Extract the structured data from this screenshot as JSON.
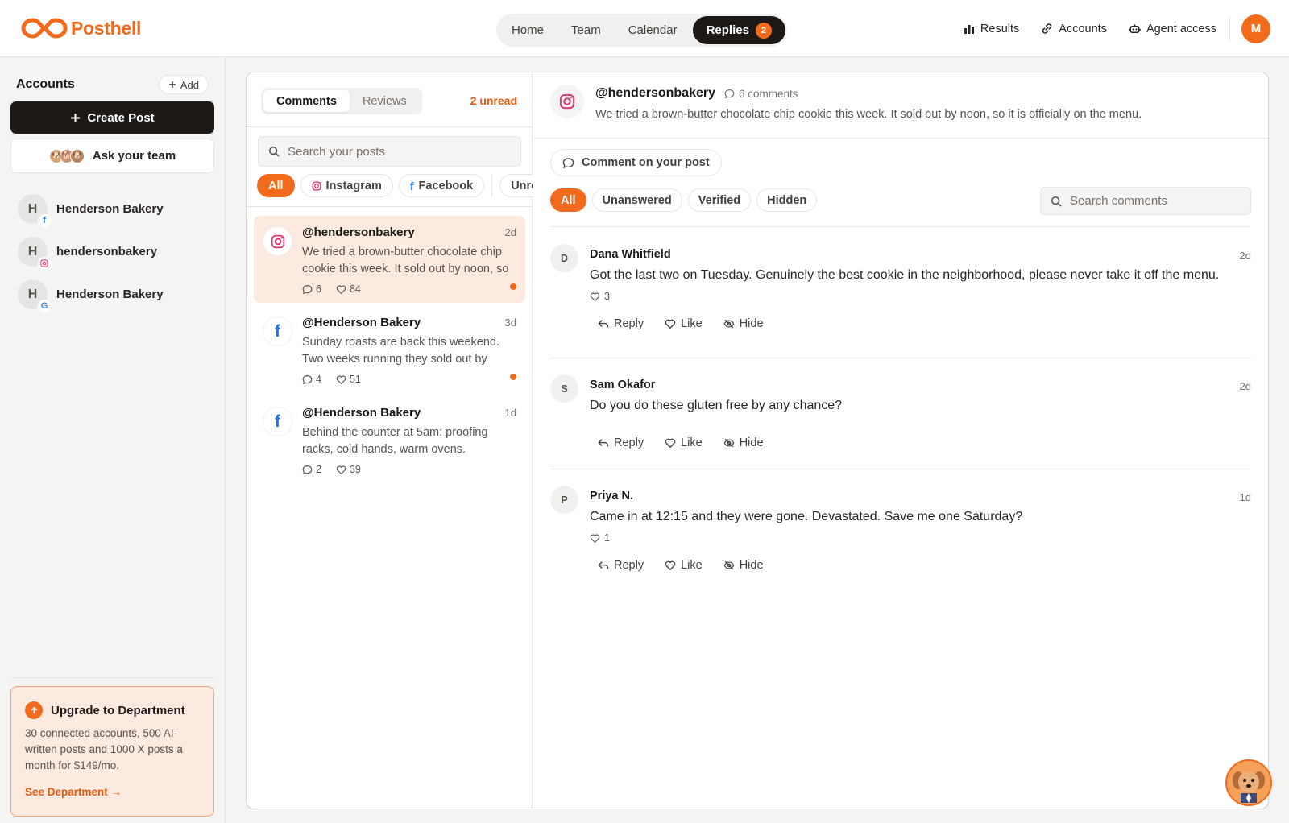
{
  "app": {
    "brand": "Posthell"
  },
  "nav": {
    "items": [
      {
        "label": "Home",
        "active": false
      },
      {
        "label": "Team",
        "active": false
      },
      {
        "label": "Calendar",
        "active": false
      }
    ],
    "replies": {
      "label": "Replies",
      "badge": "2"
    }
  },
  "top_right": {
    "results": "Results",
    "accounts": "Accounts",
    "agent_access": "Agent access",
    "avatar_initial": "M"
  },
  "sidebar": {
    "title": "Accounts",
    "add_label": "Add",
    "create_post": "Create Post",
    "ask_team": "Ask your team",
    "accounts": [
      {
        "initial": "H",
        "name": "Henderson Bakery",
        "network": "facebook"
      },
      {
        "initial": "H",
        "name": "hendersonbakery",
        "network": "instagram"
      },
      {
        "initial": "H",
        "name": "Henderson Bakery",
        "network": "google"
      }
    ],
    "upgrade": {
      "title": "Upgrade to Department",
      "body": "30 connected accounts, 500 AI-written posts and 1000 X posts a month for $149/mo.",
      "link": "See Department →"
    }
  },
  "inbox": {
    "tabs": [
      {
        "label": "Comments",
        "active": true
      },
      {
        "label": "Reviews",
        "active": false
      }
    ],
    "unread": "2 unread",
    "search_placeholder": "Search your posts",
    "filters": [
      {
        "label": "All",
        "active": true,
        "icon": ""
      },
      {
        "label": "Instagram",
        "active": false,
        "icon": "instagram"
      },
      {
        "label": "Facebook",
        "active": false,
        "icon": "facebook"
      },
      {
        "label": "Unread",
        "active": false,
        "icon": ""
      }
    ],
    "posts": [
      {
        "handle": "@hendersonbakery",
        "time": "2d",
        "network": "instagram",
        "text": "We tried a brown-butter chocolate chip cookie this week. It sold out by noon, so it is officially on the menu.",
        "comments": "6",
        "likes": "84",
        "unread": true,
        "active": true
      },
      {
        "handle": "@Henderson Bakery",
        "time": "3d",
        "network": "facebook",
        "text": "Sunday roasts are back this weekend. Two weeks running they sold out by lunch.",
        "comments": "4",
        "likes": "51",
        "unread": true,
        "active": false
      },
      {
        "handle": "@Henderson Bakery",
        "time": "1d",
        "network": "facebook",
        "text": "Behind the counter at 5am: proofing racks, cold hands, warm ovens.",
        "comments": "2",
        "likes": "39",
        "unread": false,
        "active": false
      }
    ]
  },
  "detail": {
    "handle": "@hendersonbakery",
    "comment_count": "6 comments",
    "description": "We tried a brown-butter chocolate chip cookie this week. It sold out by noon, so it is officially on the menu.",
    "comment_button": "Comment on your post",
    "filters": [
      {
        "label": "All",
        "active": true
      },
      {
        "label": "Unanswered",
        "active": false
      },
      {
        "label": "Verified",
        "active": false
      },
      {
        "label": "Hidden",
        "active": false
      }
    ],
    "search_placeholder": "Search comments",
    "actions": {
      "reply": "Reply",
      "like": "Like",
      "hide": "Hide"
    },
    "comments": [
      {
        "initial": "D",
        "name": "Dana Whitfield",
        "time": "2d",
        "text": "Got the last two on Tuesday. Genuinely the best cookie in the neighborhood, please never take it off the menu.",
        "likes": "3"
      },
      {
        "initial": "S",
        "name": "Sam Okafor",
        "time": "2d",
        "text": "Do you do these gluten free by any chance?",
        "likes": ""
      },
      {
        "initial": "P",
        "name": "Priya N.",
        "time": "1d",
        "text": "Came in at 12:15 and they were gone. Devastated. Save me one Saturday?",
        "likes": "1"
      }
    ]
  },
  "colors": {
    "accent": "#f26b1d",
    "dark": "#1c1917",
    "instagram": "#e1306c",
    "facebook": "#1877f2"
  }
}
